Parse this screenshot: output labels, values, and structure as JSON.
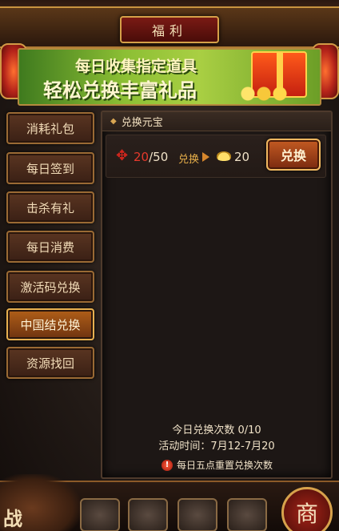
{
  "header": {
    "title": "福利"
  },
  "banner": {
    "line1": "每日收集指定道具",
    "line2": "轻松兑换丰富礼品"
  },
  "sidebar": {
    "items": [
      {
        "label": "消耗礼包"
      },
      {
        "label": "每日签到"
      },
      {
        "label": "击杀有礼"
      },
      {
        "label": "每日消费"
      },
      {
        "label": "激活码兑换"
      },
      {
        "label": "中国结兑换",
        "active": true
      },
      {
        "label": "资源找回"
      }
    ]
  },
  "panel": {
    "title": "兑换元宝",
    "reward": {
      "have": "20",
      "separator": "/",
      "need": "50",
      "exchange_word": "兑换",
      "ingot_amount": "20",
      "button_label": "兑换",
      "item_icon": "chinese-knot-icon",
      "reward_icon": "gold-ingot-icon"
    },
    "daily_count": "今日兑换次数 0/10",
    "activity_time": "活动时间：7月12-7月20",
    "notice": "每日五点重置兑换次数"
  },
  "bottom": {
    "shop_label": "商",
    "fight_label": "战"
  },
  "colors": {
    "accent": "#d5a048",
    "active_tab": "#b15f18",
    "have_count": "#e5392c"
  }
}
